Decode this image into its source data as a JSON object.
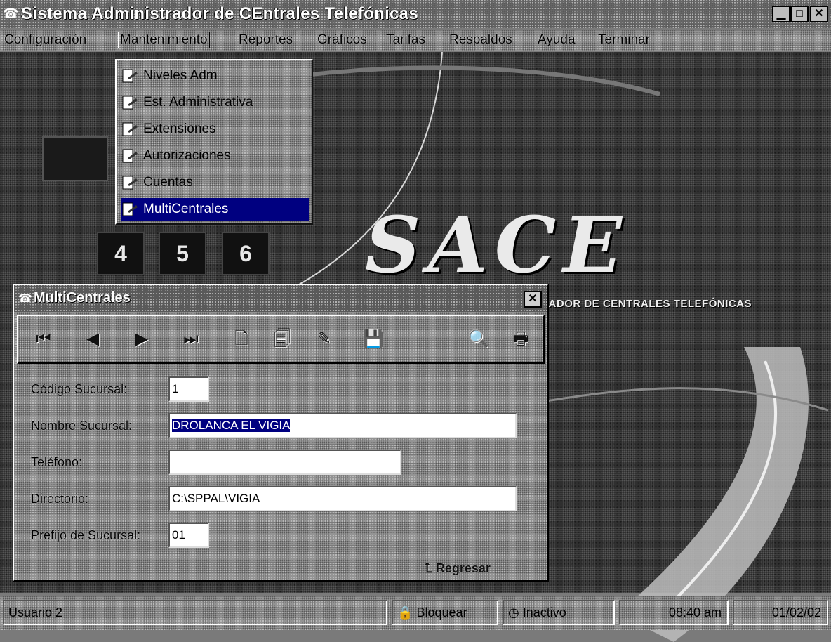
{
  "app": {
    "title": "Sistema Administrador de CEntrales Telefónicas",
    "icon": "phone-app-icon",
    "window_buttons": {
      "minimize": "▁",
      "maximize": "□",
      "close": "✕"
    }
  },
  "menubar": {
    "items": [
      {
        "label": "Configuración"
      },
      {
        "label": "Mantenimiento"
      },
      {
        "label": "Reportes"
      },
      {
        "label": "Gráficos"
      },
      {
        "label": "Tarifas"
      },
      {
        "label": "Respaldos"
      },
      {
        "label": "Ayuda"
      },
      {
        "label": "Terminar"
      }
    ],
    "active": "Mantenimiento"
  },
  "dropdown": {
    "items": [
      {
        "label": "Niveles Adm"
      },
      {
        "label": "Est. Administrativa"
      },
      {
        "label": "Extensiones"
      },
      {
        "label": "Autorizaciones"
      },
      {
        "label": "Cuentas"
      },
      {
        "label": "MultiCentrales"
      }
    ],
    "selected": "MultiCentrales"
  },
  "background": {
    "logo": "SACE",
    "subtitle": "SISTEMA ADMINISTRADOR DE CENTRALES TELEFÓNICAS",
    "keys": [
      "4",
      "5",
      "6"
    ]
  },
  "dialog": {
    "title": "MultiCentrales",
    "close": "✕",
    "toolbar": [
      {
        "icon": "first-record-icon",
        "glyph": "⏮"
      },
      {
        "icon": "previous-record-icon",
        "glyph": "◀"
      },
      {
        "icon": "next-record-icon",
        "glyph": "▶"
      },
      {
        "icon": "last-record-icon",
        "glyph": "⏭"
      },
      {
        "icon": "new-record-icon",
        "glyph": "🗋"
      },
      {
        "icon": "copy-record-icon",
        "glyph": "🗐"
      },
      {
        "icon": "edit-record-icon",
        "glyph": "✎"
      },
      {
        "icon": "save-record-icon",
        "glyph": "💾"
      },
      {
        "icon": "find-record-icon",
        "glyph": "🔍"
      },
      {
        "icon": "print-record-icon",
        "glyph": "🖶"
      }
    ],
    "fields": {
      "codigo": {
        "label": "Código Sucursal:",
        "value": "1"
      },
      "nombre": {
        "label": "Nombre Sucursal:",
        "value": "DROLANCA EL VIGIA"
      },
      "telefono": {
        "label": "Teléfono:",
        "value": ""
      },
      "directorio": {
        "label": "Directorio:",
        "value": "C:\\SPPAL\\VIGIA"
      },
      "prefijo": {
        "label": "Prefijo de Sucursal:",
        "value": "01"
      }
    },
    "regresar": "Regresar"
  },
  "statusbar": {
    "usuario": "Usuario 2",
    "bloquear": "Bloquear",
    "estado": "Inactivo",
    "hora": "08:40 am",
    "fecha": "01/02/02"
  }
}
